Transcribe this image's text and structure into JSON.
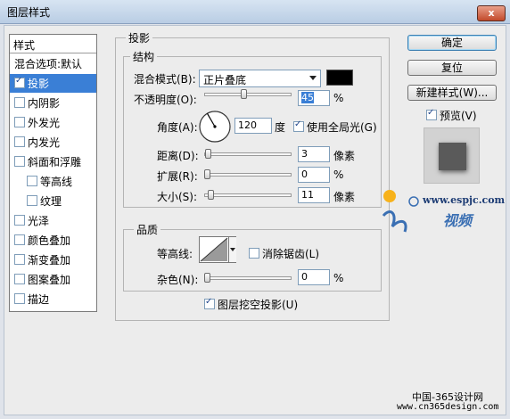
{
  "window": {
    "title": "图层样式",
    "close_glyph": "x"
  },
  "style_list": {
    "header": "样式",
    "items": [
      {
        "label": "混合选项:默认",
        "checkbox": false,
        "checked": false,
        "sub": false,
        "selected": false
      },
      {
        "label": "投影",
        "checkbox": true,
        "checked": true,
        "sub": false,
        "selected": true
      },
      {
        "label": "内阴影",
        "checkbox": true,
        "checked": false,
        "sub": false,
        "selected": false
      },
      {
        "label": "外发光",
        "checkbox": true,
        "checked": false,
        "sub": false,
        "selected": false
      },
      {
        "label": "内发光",
        "checkbox": true,
        "checked": false,
        "sub": false,
        "selected": false
      },
      {
        "label": "斜面和浮雕",
        "checkbox": true,
        "checked": false,
        "sub": false,
        "selected": false
      },
      {
        "label": "等高线",
        "checkbox": true,
        "checked": false,
        "sub": true,
        "selected": false
      },
      {
        "label": "纹理",
        "checkbox": true,
        "checked": false,
        "sub": true,
        "selected": false
      },
      {
        "label": "光泽",
        "checkbox": true,
        "checked": false,
        "sub": false,
        "selected": false
      },
      {
        "label": "颜色叠加",
        "checkbox": true,
        "checked": false,
        "sub": false,
        "selected": false
      },
      {
        "label": "渐变叠加",
        "checkbox": true,
        "checked": false,
        "sub": false,
        "selected": false
      },
      {
        "label": "图案叠加",
        "checkbox": true,
        "checked": false,
        "sub": false,
        "selected": false
      },
      {
        "label": "描边",
        "checkbox": true,
        "checked": false,
        "sub": false,
        "selected": false
      }
    ]
  },
  "drop_shadow": {
    "title": "投影",
    "structure": {
      "title": "结构",
      "blend_mode_label": "混合模式(B):",
      "blend_mode_value": "正片叠底",
      "shadow_color": "#000000",
      "opacity_label": "不透明度(O):",
      "opacity_value": "45",
      "opacity_fraction": 0.45,
      "opacity_unit": "%",
      "angle_label": "角度(A):",
      "angle_value": "120",
      "angle_unit": "度",
      "global_light_label": "使用全局光(G)",
      "global_light_checked": true,
      "distance_label": "距离(D):",
      "distance_value": "3",
      "distance_unit": "像素",
      "distance_fraction": 0.01,
      "spread_label": "扩展(R):",
      "spread_value": "0",
      "spread_unit": "%",
      "spread_fraction": 0.0,
      "size_label": "大小(S):",
      "size_value": "11",
      "size_unit": "像素",
      "size_fraction": 0.04
    },
    "quality": {
      "title": "品质",
      "contour_label": "等高线:",
      "anti_alias_label": "消除锯齿(L)",
      "anti_alias_checked": false,
      "noise_label": "杂色(N):",
      "noise_value": "0",
      "noise_unit": "%",
      "noise_fraction": 0.0
    },
    "knockout_label": "图层挖空投影(U)",
    "knockout_checked": true
  },
  "buttons": {
    "ok": "确定",
    "reset": "复位",
    "new_style": "新建样式(W)...",
    "preview_label": "预览(V)",
    "preview_checked": true
  },
  "watermark": {
    "site": "www.espjc.com",
    "site_cn": "视频",
    "footer_line1": "中国-365设计网",
    "footer_line2": "www.cn365design.com"
  }
}
